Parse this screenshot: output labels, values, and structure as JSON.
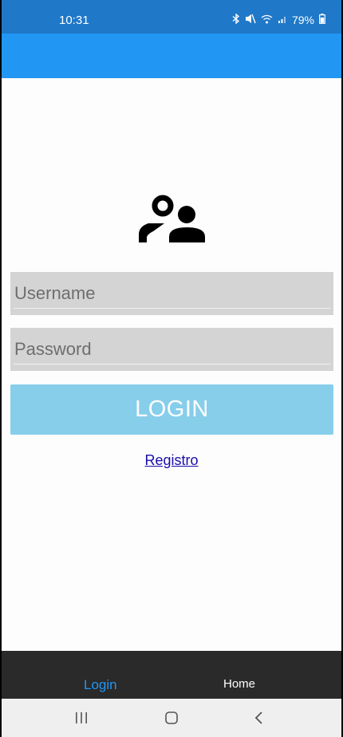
{
  "status_bar": {
    "time": "10:31",
    "icons": [
      "bluetooth-icon",
      "mute-icon",
      "wifi-icon",
      "signal-icon"
    ],
    "battery": "79%"
  },
  "colors": {
    "status_bar": "#1f78c8",
    "app_bar": "#2196f3",
    "field_bg": "#d4d4d4",
    "login_button": "#87ceeb",
    "tab_bar": "#2a2a2a",
    "tab_active": "#2196f3",
    "link": "#1a0dab"
  },
  "login_form": {
    "avatar_icon": "people-icon",
    "username_placeholder": "Username",
    "password_placeholder": "Password",
    "login_label": "LOGIN",
    "register_label": "Registro"
  },
  "tab_bar": {
    "tabs": [
      {
        "label": "Login",
        "active": true
      },
      {
        "label": "Home",
        "active": false
      }
    ]
  },
  "nav_bar": {
    "buttons": [
      "recent-apps-icon",
      "home-icon",
      "back-icon"
    ]
  }
}
